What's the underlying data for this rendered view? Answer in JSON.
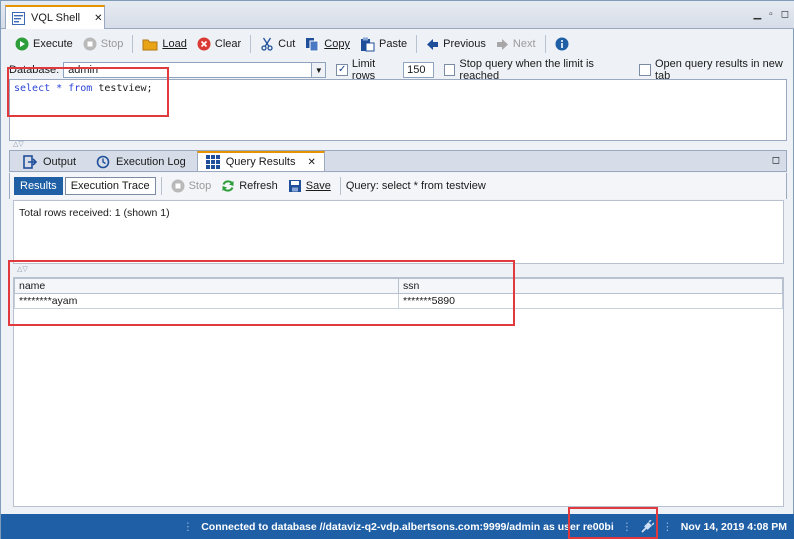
{
  "window": {
    "tab_title": "VQL Shell",
    "close_glyph": "✕"
  },
  "toolbar": {
    "execute": "Execute",
    "stop": "Stop",
    "load": "Load",
    "clear": "Clear",
    "cut": "Cut",
    "copy": "Copy",
    "paste": "Paste",
    "previous": "Previous",
    "next": "Next"
  },
  "dbrow": {
    "database_label": "Database:",
    "database_value": "admin",
    "limit_rows_label": "Limit rows",
    "limit_rows_checked": true,
    "limit_rows_value": "150",
    "stop_query_label": "Stop query when the limit is reached",
    "open_results_label": "Open query results in new tab"
  },
  "editor": {
    "kw_select": "select",
    "star": "*",
    "kw_from": "from",
    "table": "testview;"
  },
  "bottom_tabs": [
    "Output",
    "Execution Log",
    "Query Results"
  ],
  "results_toolbar": {
    "results": "Results",
    "execution_trace": "Execution Trace",
    "stop": "Stop",
    "refresh": "Refresh",
    "save": "Save",
    "query_text": "Query: select * from testview"
  },
  "message": "Total rows received: 1 (shown 1)",
  "grid": {
    "columns": [
      "name",
      "ssn"
    ],
    "rows": [
      [
        "********ayam",
        "*******5890"
      ]
    ]
  },
  "status": {
    "connection": "Connected to database //dataviz-q2-vdp.albertsons.com:9999/admin as user re00bi",
    "datetime": "Nov 14, 2019 4:08 PM"
  },
  "colors": {
    "accent": "#1f5fa6",
    "tab_highlight": "#e59400",
    "annotation_red": "#e0393e"
  }
}
